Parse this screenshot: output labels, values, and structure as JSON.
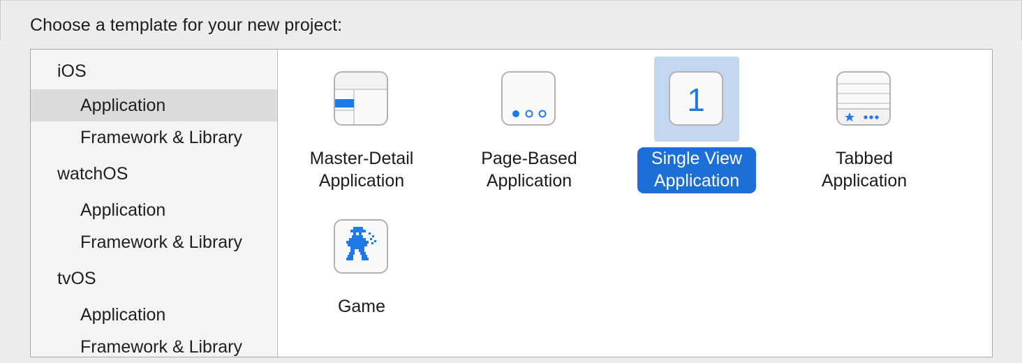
{
  "prompt": "Choose a template for your new project:",
  "sidebar": {
    "items": [
      {
        "label": "iOS",
        "kind": "platform"
      },
      {
        "label": "Application",
        "kind": "sub",
        "selected": true
      },
      {
        "label": "Framework & Library",
        "kind": "sub"
      },
      {
        "label": "watchOS",
        "kind": "platform"
      },
      {
        "label": "Application",
        "kind": "sub"
      },
      {
        "label": "Framework & Library",
        "kind": "sub"
      },
      {
        "label": "tvOS",
        "kind": "platform"
      },
      {
        "label": "Application",
        "kind": "sub"
      },
      {
        "label": "Framework & Library",
        "kind": "sub"
      }
    ]
  },
  "templates": [
    {
      "line1": "Master-Detail",
      "line2": "Application",
      "icon": "master-detail-icon"
    },
    {
      "line1": "Page-Based",
      "line2": "Application",
      "icon": "page-based-icon"
    },
    {
      "line1": "Single View",
      "line2": "Application",
      "icon": "single-view-icon",
      "icon_text": "1",
      "selected": true
    },
    {
      "line1": "Tabbed",
      "line2": "Application",
      "icon": "tabbed-icon"
    },
    {
      "line1": "Game",
      "line2": "",
      "icon": "game-icon"
    }
  ],
  "colors": {
    "accent": "#1b6fd6",
    "selection_bg": "#c3d7f0",
    "icon_blue": "#1f7ae8"
  }
}
